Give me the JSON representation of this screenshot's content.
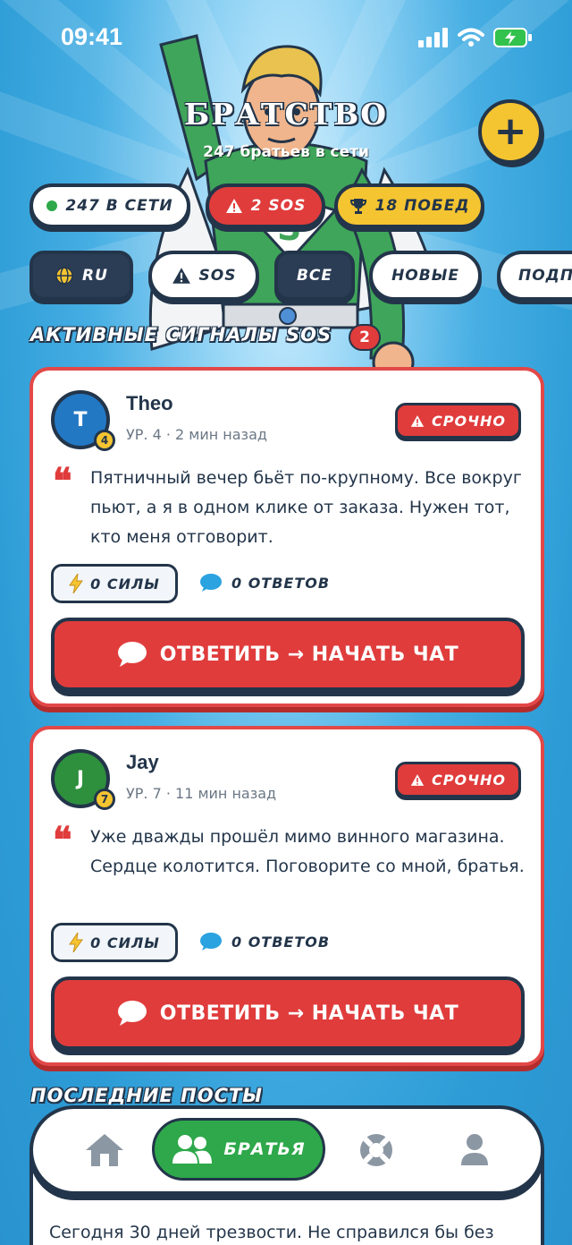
{
  "status_bar": {
    "time": "09:41"
  },
  "header": {
    "title": "БРАТСТВО",
    "subtitle": "247 братьев в сети",
    "add_icon": "plus-icon"
  },
  "stats": [
    {
      "label": "247 В СЕТИ",
      "icon": "online-dot",
      "color": "#2ea84a"
    },
    {
      "label": "2 SOS",
      "icon": "warning-icon",
      "color": "#e03c3c"
    },
    {
      "label": "18 ПОБЕД",
      "icon": "trophy-icon",
      "color": "#f5c431"
    }
  ],
  "filters": [
    {
      "label": "RU",
      "icon": "globe-icon",
      "active": true
    },
    {
      "label": "SOS",
      "icon": "warning-icon",
      "active": false
    },
    {
      "label": "ВСЕ",
      "active": true
    },
    {
      "label": "НОВЫЕ",
      "active": false
    },
    {
      "label": "ПОДП",
      "active": false
    }
  ],
  "sos_section": {
    "title": "АКТИВНЫЕ СИГНАЛЫ SOS",
    "count": "2"
  },
  "sos_cards": [
    {
      "initial": "T",
      "level": "4",
      "name": "Theo",
      "meta": "УР. 4 · 2 мин назад",
      "urgent_label": "СРОЧНО",
      "message": "Пятничный вечер бьёт по-крупному. Все вокруг пьют, а я в одном клике от заказа. Нужен тот, кто меня отговорит.",
      "power": "0 СИЛЫ",
      "replies": "0 ОТВЕТОВ",
      "reply_button": "ОТВЕТИТЬ → НАЧАТЬ ЧАТ",
      "avatar_color": "#2378c4"
    },
    {
      "initial": "J",
      "level": "7",
      "name": "Jay",
      "meta": "УР. 7 · 11 мин назад",
      "urgent_label": "СРОЧНО",
      "message": "Уже дважды прошёл мимо винного магазина. Сердце колотится. Поговорите со мной, братья.",
      "power": "0 СИЛЫ",
      "replies": "0 ОТВЕТОВ",
      "reply_button": "ОТВЕТИТЬ → НАЧАТЬ ЧАТ",
      "avatar_color": "#2e8f3d"
    }
  ],
  "posts_section": {
    "title": "ПОСЛЕДНИЕ ПОСТЫ"
  },
  "post_preview": {
    "text": "Сегодня 30 дней трезвости. Не справился бы без"
  },
  "bottom_nav": {
    "home_icon": "home-icon",
    "brothers_label": "БРАТЬЯ",
    "brothers_icon": "users-icon",
    "support_icon": "lifebuoy-icon",
    "profile_icon": "user-icon"
  },
  "colors": {
    "accent_red": "#e03c3c",
    "accent_green": "#2ea84a",
    "accent_yellow": "#f5c431",
    "outline": "#23354a"
  }
}
